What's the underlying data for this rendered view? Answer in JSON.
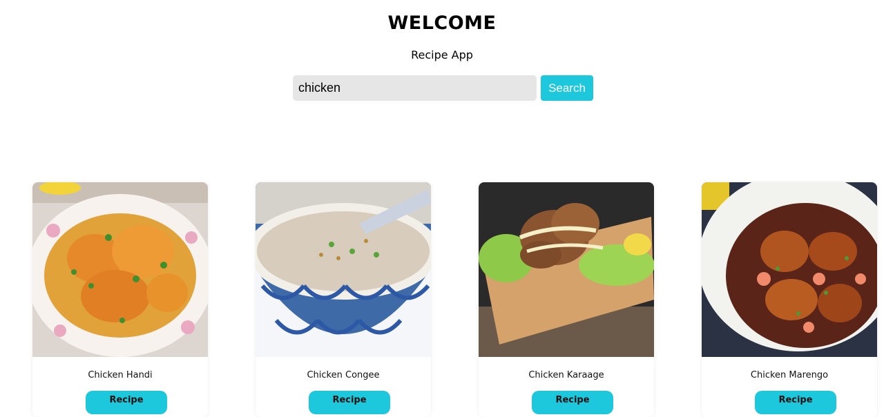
{
  "header": {
    "title": "WELCOME",
    "subtitle": "Recipe App"
  },
  "search": {
    "value": "chicken",
    "button_label": "Search"
  },
  "recipes": [
    {
      "name": "Chicken Handi",
      "button_label": "Recipe",
      "image": "chicken-handi-photo"
    },
    {
      "name": "Chicken Congee",
      "button_label": "Recipe",
      "image": "chicken-congee-photo"
    },
    {
      "name": "Chicken Karaage",
      "button_label": "Recipe",
      "image": "chicken-karaage-photo"
    },
    {
      "name": "Chicken Marengo",
      "button_label": "Recipe",
      "image": "chicken-marengo-photo"
    }
  ],
  "colors": {
    "accent": "#1ec8dc",
    "input_bg": "#e6e6e6"
  }
}
